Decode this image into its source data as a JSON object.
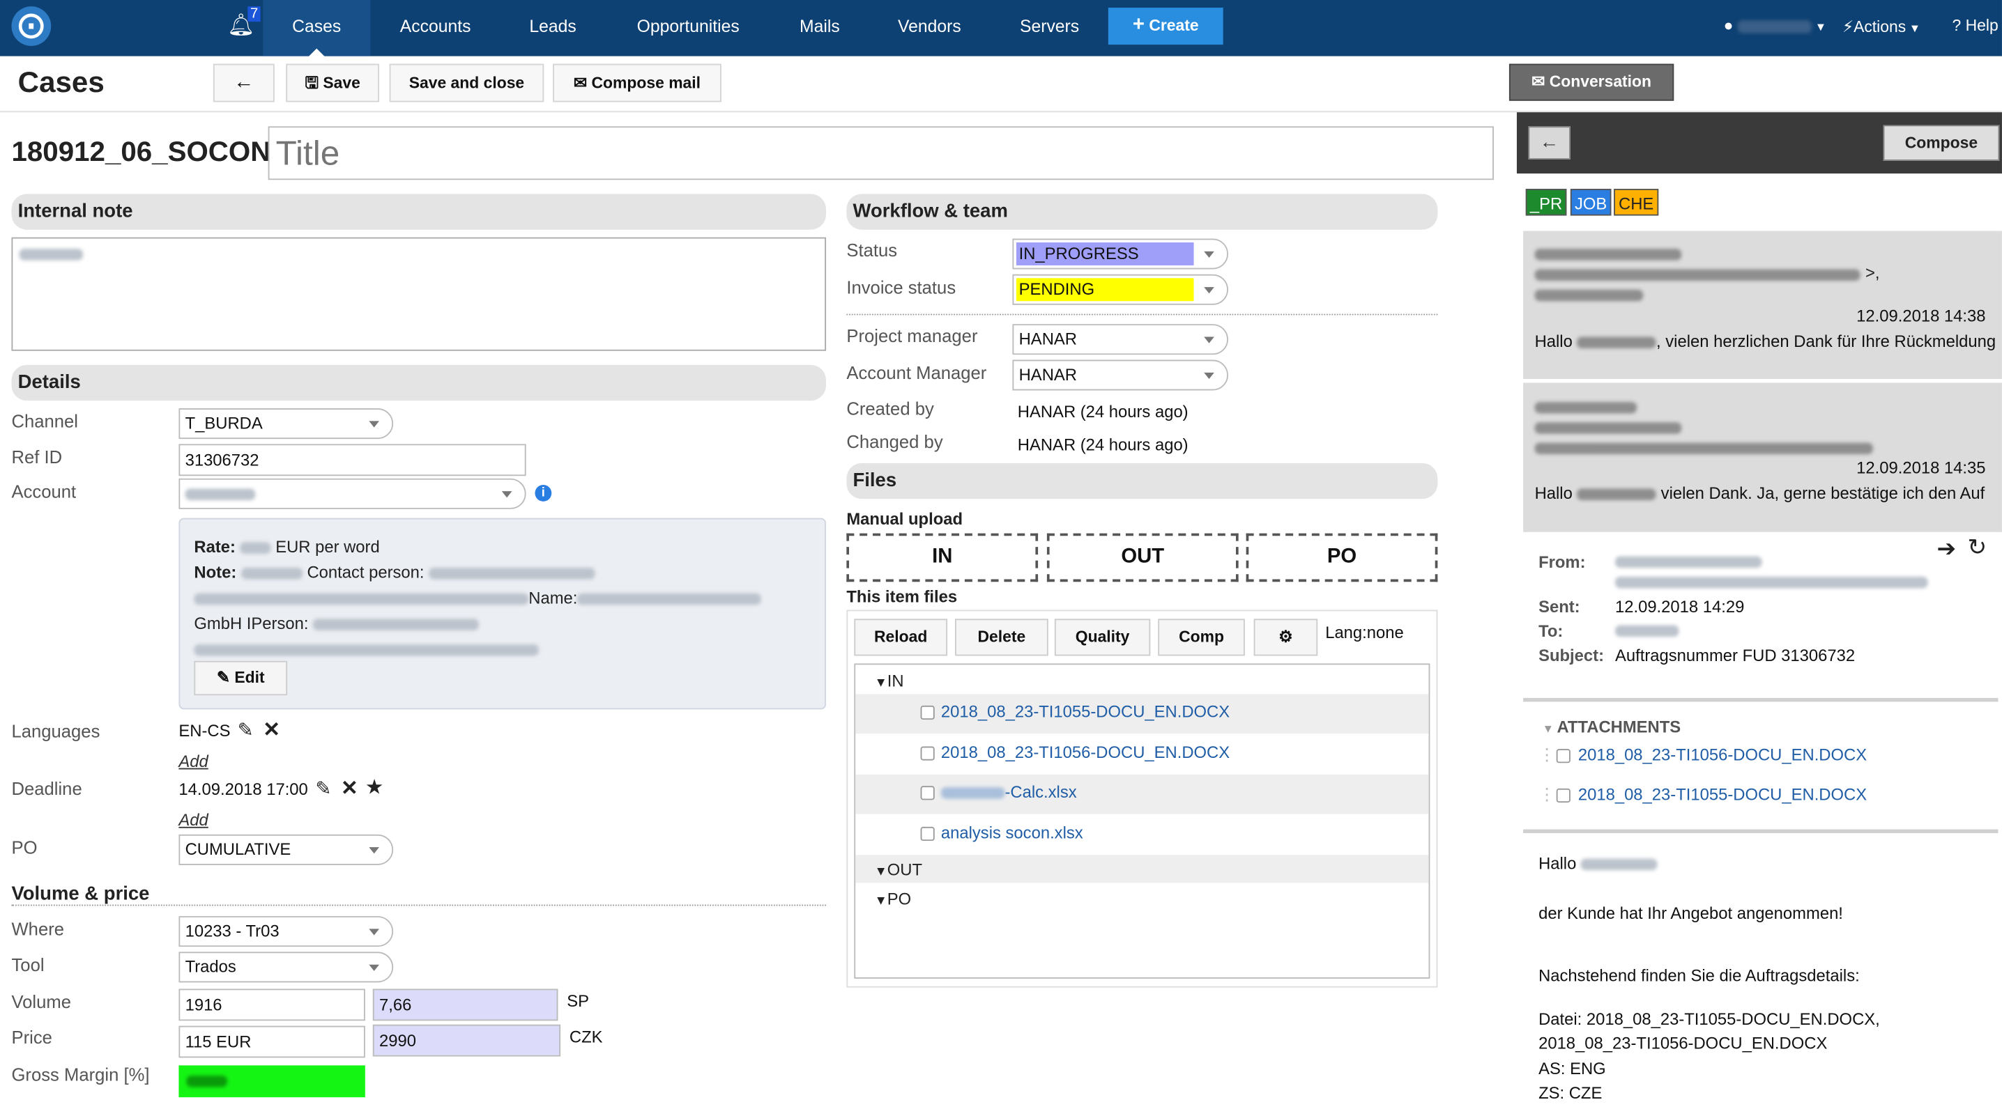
{
  "nav": {
    "notif_count": "7",
    "items": [
      "Cases",
      "Accounts",
      "Leads",
      "Opportunities",
      "Mails",
      "Vendors",
      "Servers"
    ],
    "create": "Create",
    "actions": "Actions",
    "help": "Help"
  },
  "toolbar": {
    "page_title": "Cases",
    "save": "Save",
    "save_close": "Save and close",
    "compose_mail": "Compose mail",
    "conversation": "Conversation"
  },
  "case": {
    "id": "180912_06_SOCON",
    "title_placeholder": "Title"
  },
  "internal_note": {
    "header": "Internal note"
  },
  "details": {
    "header": "Details",
    "channel_label": "Channel",
    "channel_value": "T_BURDA",
    "refid_label": "Ref ID",
    "refid_value": "31306732",
    "account_label": "Account",
    "rate_label": "Rate:",
    "rate_suffix": "EUR per word",
    "note_label": "Note:",
    "contact_person": "Contact person:",
    "name_label": "Name:",
    "gmbh": "GmbH IPerson:",
    "edit": "Edit",
    "languages_label": "Languages",
    "languages_value": "EN-CS",
    "add": "Add",
    "deadline_label": "Deadline",
    "deadline_value": "14.09.2018 17:00",
    "po_label": "PO",
    "po_value": "CUMULATIVE"
  },
  "volume": {
    "header": "Volume & price",
    "where_label": "Where",
    "where_value": "10233 - Tr03",
    "tool_label": "Tool",
    "tool_value": "Trados",
    "volume_label": "Volume",
    "volume_value": "1916",
    "volume_calc": "7,66",
    "volume_unit": "SP",
    "price_label": "Price",
    "price_value": "115 EUR",
    "price_calc": "2990",
    "price_unit": "CZK",
    "margin_label": "Gross Margin [%]"
  },
  "workflow": {
    "header": "Workflow & team",
    "status_label": "Status",
    "status_value": "IN_PROGRESS",
    "invoice_label": "Invoice status",
    "invoice_value": "PENDING",
    "pm_label": "Project manager",
    "pm_value": "HANAR",
    "am_label": "Account Manager",
    "am_value": "HANAR",
    "created_label": "Created by",
    "created_value": "HANAR (24 hours ago)",
    "changed_label": "Changed by",
    "changed_value": "HANAR (24 hours ago)"
  },
  "files": {
    "header": "Files",
    "manual_upload": "Manual upload",
    "upload_in": "IN",
    "upload_out": "OUT",
    "upload_po": "PO",
    "item_files": "This item files",
    "reload": "Reload",
    "delete": "Delete",
    "quality": "Quality",
    "comp": "Comp",
    "lang": "Lang:none",
    "folder_in": "IN",
    "folder_out": "OUT",
    "folder_po": "PO",
    "file1": "2018_08_23-TI1055-DOCU_EN.DOCX",
    "file2": "2018_08_23-TI1056-DOCU_EN.DOCX",
    "file3": "-Calc.xlsx",
    "file4": "analysis socon.xlsx"
  },
  "conversation": {
    "compose": "Compose",
    "tags": [
      "_PR",
      "JOB",
      "CHE"
    ],
    "tag_colors": [
      "#1e8a2e",
      "#2a7de1",
      "#ffb000"
    ],
    "msg1_date": "12.09.2018 14:38",
    "msg1_hallo": "Hallo",
    "msg1_text": ", vielen herzlichen Dank für Ihre Rückmeldung",
    "msg2_date": "12.09.2018 14:35",
    "msg2_hallo": "Hallo",
    "msg2_text": " vielen Dank. Ja, gerne bestätige ich den Auf",
    "from_label": "From:",
    "sent_label": "Sent:",
    "sent_value": "12.09.2018 14:29",
    "to_label": "To:",
    "subject_label": "Subject:",
    "subject_value": "Auftragsnummer FUD 31306732",
    "attachments": "ATTACHMENTS",
    "att1": "2018_08_23-TI1056-DOCU_EN.DOCX",
    "att2": "2018_08_23-TI1055-DOCU_EN.DOCX",
    "body_hallo": "Hallo",
    "body_line1": "der Kunde hat Ihr Angebot angenommen!",
    "body_line2": "Nachstehend finden Sie die Auftragsdetails:",
    "body_line3": "Datei: 2018_08_23-TI1055-DOCU_EN.DOCX,",
    "body_line4": "2018_08_23-TI1056-DOCU_EN.DOCX",
    "body_line5": "AS: ENG",
    "body_line6": "ZS: CZE"
  }
}
